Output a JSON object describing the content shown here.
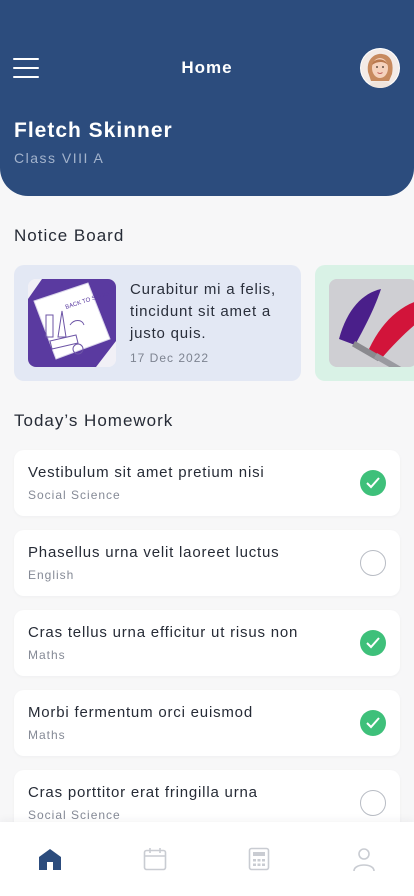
{
  "header": {
    "title": "Home",
    "user_name": "Fletch Skinner",
    "user_class": "Class VIII A"
  },
  "notice_board": {
    "title": "Notice Board",
    "items": [
      {
        "text": "Curabitur mi a felis, tincidunt sit amet a justo quis.",
        "date": "17 Dec 2022",
        "image_text": "BACK TO SCHOOL"
      }
    ]
  },
  "homework": {
    "title": "Today’s Homework",
    "items": [
      {
        "title": "Vestibulum sit amet pretium nisi",
        "subject": "Social Science",
        "done": true
      },
      {
        "title": "Phasellus urna velit laoreet luctus",
        "subject": "English",
        "done": false
      },
      {
        "title": "Cras tellus urna efficitur ut risus non",
        "subject": "Maths",
        "done": true
      },
      {
        "title": "Morbi fermentum orci euismod",
        "subject": "Maths",
        "done": true
      },
      {
        "title": "Cras porttitor erat fringilla urna",
        "subject": "Social Science",
        "done": false
      }
    ]
  },
  "bottom_nav": {
    "items": [
      {
        "icon": "home-icon",
        "active": true
      },
      {
        "icon": "calendar-icon",
        "active": false
      },
      {
        "icon": "calculator-icon",
        "active": false
      },
      {
        "icon": "profile-icon",
        "active": false
      }
    ]
  },
  "colors": {
    "header_bg": "#2c4c7d",
    "done_green": "#3ec07a",
    "notice_blue": "#e3e8f4",
    "notice_green": "#d9f2e6",
    "nav_active": "#2c4c7d",
    "nav_inactive": "#c9ccd2"
  }
}
